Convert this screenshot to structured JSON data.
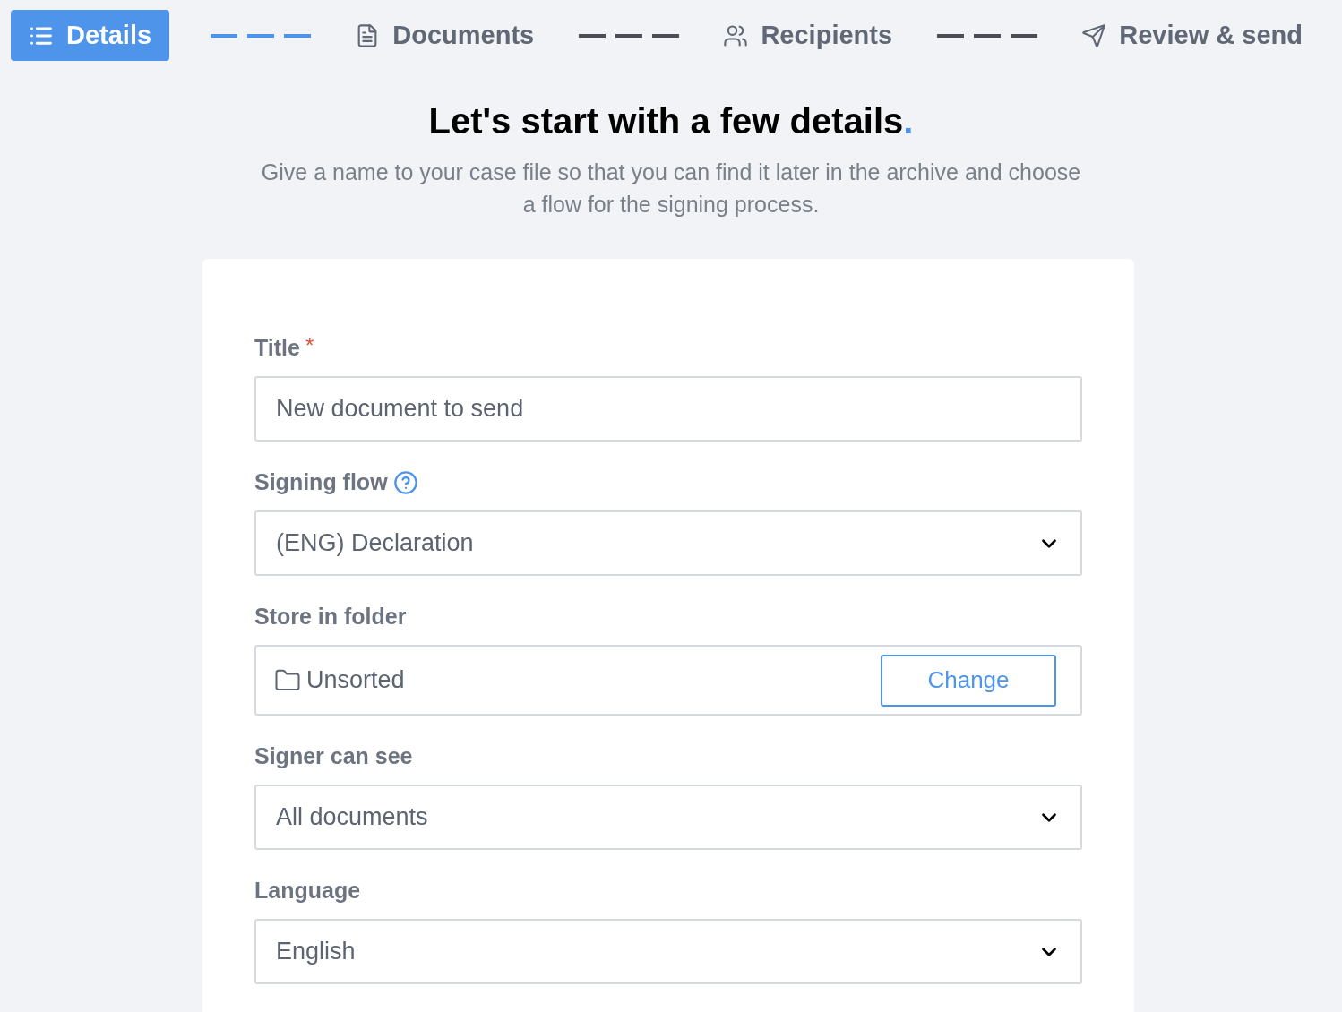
{
  "steps": [
    {
      "label": "Details",
      "selected": true,
      "connector_completed": true
    },
    {
      "label": "Documents",
      "selected": false,
      "connector_completed": false
    },
    {
      "label": "Recipients",
      "selected": false,
      "connector_completed": false
    },
    {
      "label": "Review & send",
      "selected": false
    }
  ],
  "heading": {
    "text": "Let's start with a few details",
    "accent": "."
  },
  "subtitle": "Give a name to your case file so that you can find it later in the archive and choose a flow for the signing process.",
  "fields": [
    {
      "kind": "text",
      "label": "Title",
      "required_mark": "*",
      "help": false,
      "placeholder": "New document to send"
    },
    {
      "kind": "select",
      "label": "Signing flow",
      "help": true,
      "value": "(ENG) Declaration"
    },
    {
      "kind": "folder",
      "label": "Store in folder",
      "help": false,
      "value": "Unsorted",
      "button": "Change"
    },
    {
      "kind": "select",
      "label": "Signer can see",
      "help": false,
      "value": "All documents"
    },
    {
      "kind": "select",
      "label": "Language",
      "help": false,
      "value": "English"
    }
  ]
}
